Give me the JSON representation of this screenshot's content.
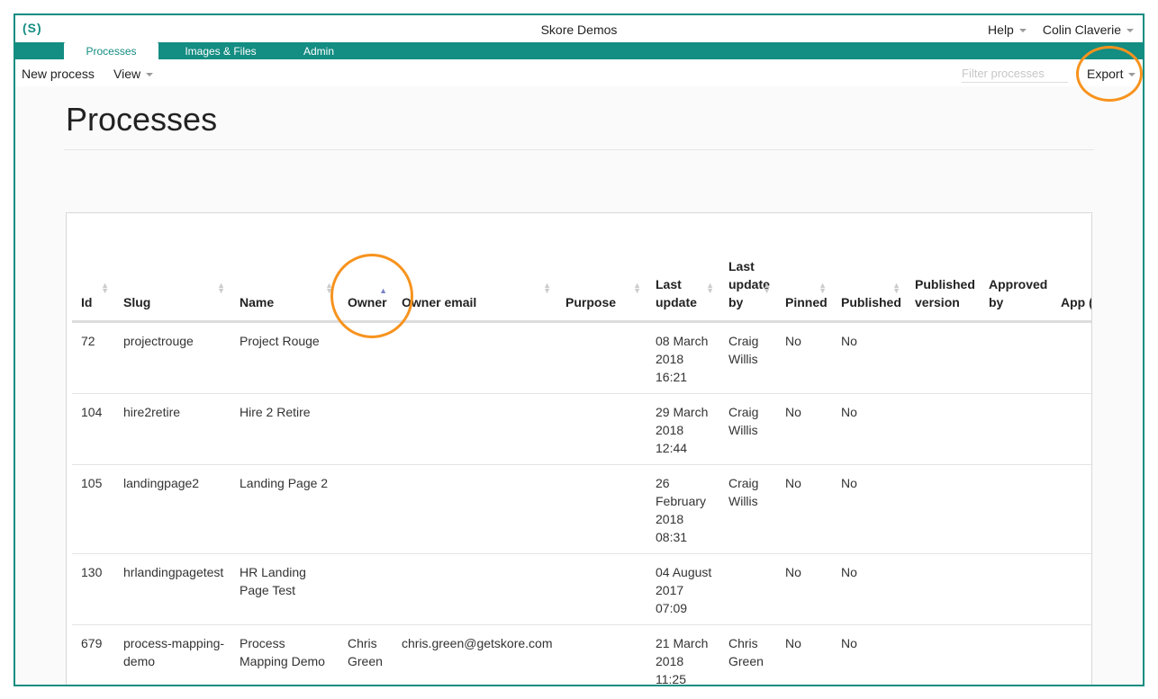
{
  "app": {
    "logo": "(S)",
    "title": "Skore Demos"
  },
  "top_right": {
    "help": "Help",
    "user": "Colin Claverie"
  },
  "tabs": [
    {
      "label": "Processes",
      "active": true
    },
    {
      "label": "Images & Files",
      "active": false
    },
    {
      "label": "Admin",
      "active": false
    }
  ],
  "toolbar": {
    "new_process": "New process",
    "view": "View",
    "filter_placeholder": "Filter processes",
    "export": "Export"
  },
  "page": {
    "title": "Processes"
  },
  "table": {
    "columns": {
      "id": "Id",
      "slug": "Slug",
      "name": "Name",
      "owner": "Owner",
      "owner_email": "Owner email",
      "purpose": "Purpose",
      "last_update": "Last update",
      "last_update_by": "Last update by",
      "pinned": "Pinned",
      "published": "Published",
      "published_version": "Published version",
      "approved_by": "Approved by",
      "approved_email": "App (em"
    },
    "sorted_column": "Owner",
    "rows": [
      {
        "id": "72",
        "slug": "projectrouge",
        "name": "Project Rouge",
        "owner": "",
        "owner_email": "",
        "purpose": "",
        "last_update": "08 March 2018 16:21",
        "last_update_by": "Craig Willis",
        "pinned": "No",
        "published": "No"
      },
      {
        "id": "104",
        "slug": "hire2retire",
        "name": "Hire 2 Retire",
        "owner": "",
        "owner_email": "",
        "purpose": "",
        "last_update": "29 March 2018 12:44",
        "last_update_by": "Craig Willis",
        "pinned": "No",
        "published": "No"
      },
      {
        "id": "105",
        "slug": "landingpage2",
        "name": "Landing Page 2",
        "owner": "",
        "owner_email": "",
        "purpose": "",
        "last_update": "26 February 2018 08:31",
        "last_update_by": "Craig Willis",
        "pinned": "No",
        "published": "No"
      },
      {
        "id": "130",
        "slug": "hrlandingpagetest",
        "name": "HR Landing Page Test",
        "owner": "",
        "owner_email": "",
        "purpose": "",
        "last_update": "04 August 2017 07:09",
        "last_update_by": "",
        "pinned": "No",
        "published": "No"
      },
      {
        "id": "679",
        "slug": "process-mapping-demo",
        "name": "Process Mapping Demo",
        "owner": "Chris Green",
        "owner_email": "chris.green@getskore.com",
        "purpose": "",
        "last_update": "21 March 2018 11:25",
        "last_update_by": "Chris Green",
        "pinned": "No",
        "published": "No"
      }
    ]
  },
  "accent_color": "#148d82",
  "highlight_color": "#f7931e"
}
